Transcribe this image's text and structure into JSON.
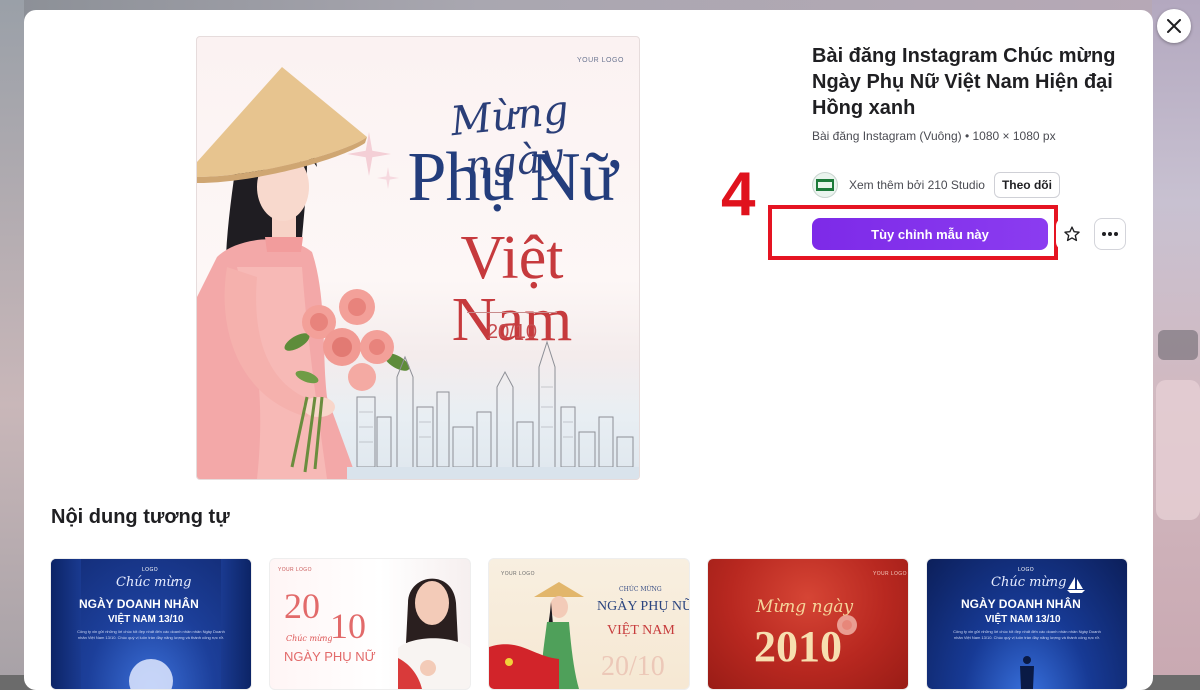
{
  "modal": {
    "close_icon": "close-icon",
    "preview": {
      "your_logo": "YOUR LOGO",
      "script_text": "Mừng ngày",
      "line1": "Phụ Nữ",
      "line2": "Việt Nam",
      "date": "20/10"
    },
    "info": {
      "title": "Bài đăng Instagram Chúc mừng Ngày Phụ Nữ Việt Nam Hiện đại Hồng xanh",
      "meta": "Bài đăng Instagram (Vuông) • 1080 × 1080 px",
      "creator_text": "Xem thêm bởi 210 Studio",
      "follow_label": "Theo dõi",
      "customize_label": "Tùy chỉnh mẫu này",
      "star_icon": "star-icon",
      "more_icon": "more-icon"
    },
    "annotation": {
      "step_number": "4",
      "highlight_color": "#e51422"
    },
    "similar": {
      "title": "Nội dung tương tự",
      "cards": [
        {
          "logo": "LOGO",
          "script": "Chúc mừng",
          "big1": "NGÀY DOANH NHÂN",
          "big2": "VIỆT NAM 13/10",
          "body": "Công ty xin gửi những lời chúc tốt đẹp nhất đến các doanh nhân nhân Ngày Doanh nhân Việt Nam 13/10. Chúc quý vị luôn tràn đầy năng lượng và thành công rực rỡ."
        },
        {
          "logo": "YOUR LOGO",
          "big1": "20",
          "big2": "10",
          "script": "Chúc mừng",
          "big3": "NGÀY PHỤ NỮ"
        },
        {
          "logo": "YOUR LOGO",
          "script": "CHÚC MỪNG",
          "big1": "NGÀY PHỤ NỮ",
          "big2": "VIỆT NAM",
          "big3": "20/10"
        },
        {
          "logo": "YOUR LOGO",
          "script": "Mừng ngày",
          "big1": "2010"
        },
        {
          "logo": "LOGO",
          "script": "Chúc mừng",
          "big1": "NGÀY DOANH NHÂN",
          "big2": "VIỆT NAM 13/10",
          "body": "Công ty xin gửi những lời chúc tốt đẹp nhất đến các doanh nhân nhân Ngày Doanh nhân Việt Nam 13/10. Chúc quý vị luôn tràn đầy năng lượng và thành công rực rỡ."
        }
      ]
    }
  },
  "colors": {
    "accent": "#7d2ae8",
    "title_blue": "#233d7c",
    "title_red": "#c63a3d"
  }
}
